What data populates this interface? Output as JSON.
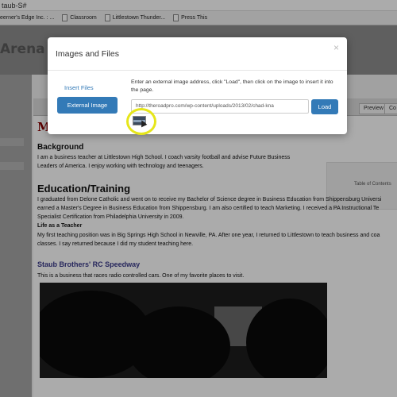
{
  "browser": {
    "address": "taub-S#",
    "bookmarks": [
      "eerner's Edge Inc. : ...",
      "Classroom",
      "Littlestown Thunder...",
      "Press This"
    ]
  },
  "site": {
    "brand": "Arena"
  },
  "editor": {
    "tabs": [
      "Preview",
      "Co"
    ],
    "page_title": "M",
    "toc_label": "Table of Contents",
    "sections": {
      "background_heading": "Background",
      "background_lines": [
        "I am a business teacher at Littlestown High School. I coach varsity football and advise Future Business",
        "Leaders of America. I enjoy working with technology and teenagers."
      ],
      "education_heading": "Education/Training",
      "education_lines": [
        "I graduated from Delone Catholic and went on to receive my Bachelor of Science degree in Business Education from Shippensburg Universi",
        "earned a Master's Degree in Business Education from Shippensburg. I am also certified to teach Marketing. I received a PA Instructional Te",
        "Specialist Certification from Philadelphia University in 2009."
      ],
      "teacher_heading": "Life as a Teacher",
      "teacher_lines": [
        "My first teaching position was in Big Springs High School in Newville, PA. After one year, I returned to Littlestown to teach business and coa",
        "classes. I say returned because I did my student teaching here."
      ],
      "link_heading": "Staub Brothers' RC Speedway",
      "link_lines": [
        "This is a business that races radio controlled cars. One of my favorite places to visit."
      ]
    }
  },
  "modal": {
    "title": "Images and Files",
    "close": "×",
    "nav_insert_files": "Insert Files",
    "nav_external_image": "External Image",
    "instructions": "Enter an external image address, click \"Load\", then click on the image to insert it into the page.",
    "url_value": "http://theroadpro.com/wp-content/uploads/2013/02/chad-kna",
    "load_label": "Load",
    "accent": "#337ab7"
  }
}
